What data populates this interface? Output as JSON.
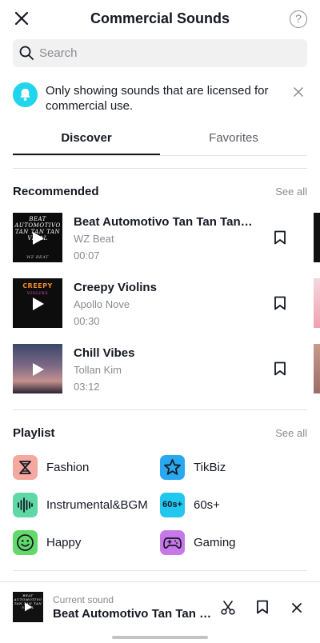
{
  "header": {
    "title": "Commercial Sounds",
    "help_glyph": "?"
  },
  "search": {
    "placeholder": "Search"
  },
  "notice": {
    "text": "Only showing sounds that are licensed for commercial use."
  },
  "tabs": [
    {
      "label": "Discover",
      "active": true
    },
    {
      "label": "Favorites",
      "active": false
    }
  ],
  "recommended": {
    "title": "Recommended",
    "see_all": "See all",
    "tracks": [
      {
        "name": "Beat Automotivo Tan Tan Tan ...",
        "artist": "WZ Beat",
        "duration": "00:07",
        "cover_text": "BEAT AUTOMOTIVO TAN TAN TAN VIRAL",
        "cover_footer": "WZ BEAT"
      },
      {
        "name": "Creepy Violins",
        "artist": "Apollo Nove",
        "duration": "00:30",
        "cover_text": "CREEPY",
        "cover_sub": "VIOLINS"
      },
      {
        "name": "Chill Vibes",
        "artist": "Tollan Kim",
        "duration": "03:12"
      }
    ]
  },
  "playlist": {
    "title": "Playlist",
    "see_all": "See all",
    "items": [
      {
        "label": "Fashion",
        "icon": "fashion-icon",
        "color": "#f4a8a0"
      },
      {
        "label": "TikBiz",
        "icon": "star-icon",
        "color": "#2aa8ef"
      },
      {
        "label": "Instrumental&BGM",
        "icon": "waveform-icon",
        "color": "#5fd8a8"
      },
      {
        "label": "60s+",
        "icon": "60s-icon",
        "color": "#22c7f0",
        "badge": "60s+"
      },
      {
        "label": "Happy",
        "icon": "smiley-icon",
        "color": "#62d96b"
      },
      {
        "label": "Gaming",
        "icon": "gamepad-icon",
        "color": "#c678e8"
      }
    ]
  },
  "current": {
    "label": "Current sound",
    "name": "Beat Automotivo Tan Tan Tan Viral"
  },
  "colors": {
    "accent": "#20d5ec",
    "text": "#161823",
    "muted": "#8a8b91",
    "divider": "#e3e3e4"
  }
}
